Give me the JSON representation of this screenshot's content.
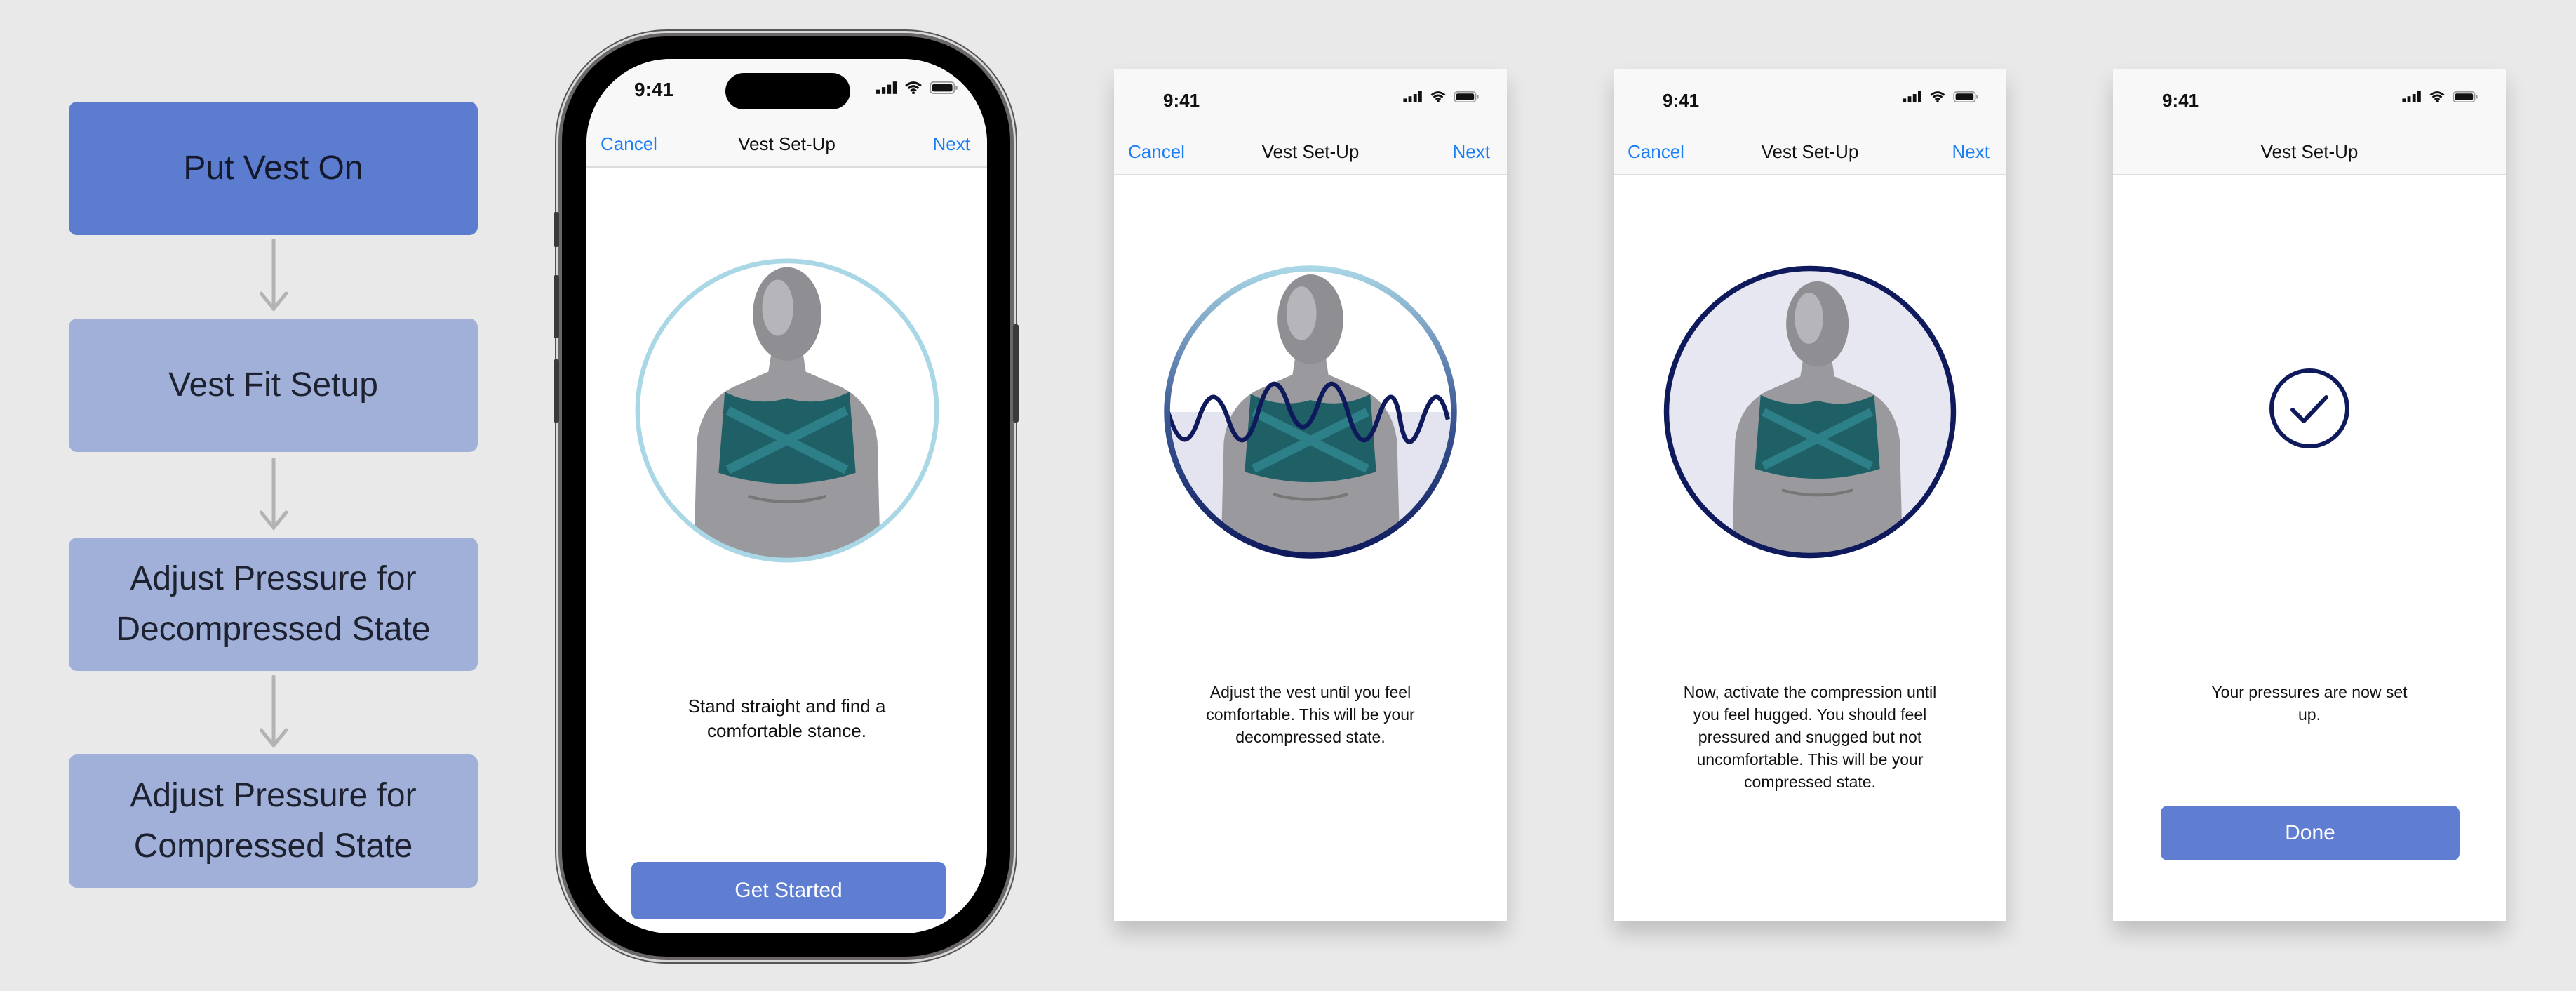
{
  "flow": {
    "steps": [
      "Put Vest On",
      "Vest Fit Setup",
      "Adjust Pressure for Decompressed State",
      "Adjust Pressure for Compressed State"
    ],
    "active_color": "#5c7cd0",
    "step_color": "#a0b0d9"
  },
  "status": {
    "time": "9:41",
    "icons": [
      "cellular-signal-icon",
      "wifi-icon",
      "battery-icon"
    ]
  },
  "screens": [
    {
      "cancel": "Cancel",
      "title": "Vest Set-Up",
      "next": "Next",
      "body": "Stand straight and find a comfortable stance.",
      "button": "Get Started"
    },
    {
      "cancel": "Cancel",
      "title": "Vest Set-Up",
      "next": "Next",
      "body": "Adjust the vest until you feel comfortable. This will be your decompressed state."
    },
    {
      "cancel": "Cancel",
      "title": "Vest Set-Up",
      "next": "Next",
      "body": "Now, activate the compression until you feel hugged. You should feel pressured and snugged but not uncomfortable. This will be your compressed state."
    },
    {
      "title": "Vest Set-Up",
      "body": "Your pressures are now set up.",
      "button": "Done"
    }
  ],
  "colors": {
    "link": "#1b7ef5",
    "button": "#5f7dd1",
    "navy": "#0f1a5c",
    "light_ring": "#a9d7e6"
  }
}
